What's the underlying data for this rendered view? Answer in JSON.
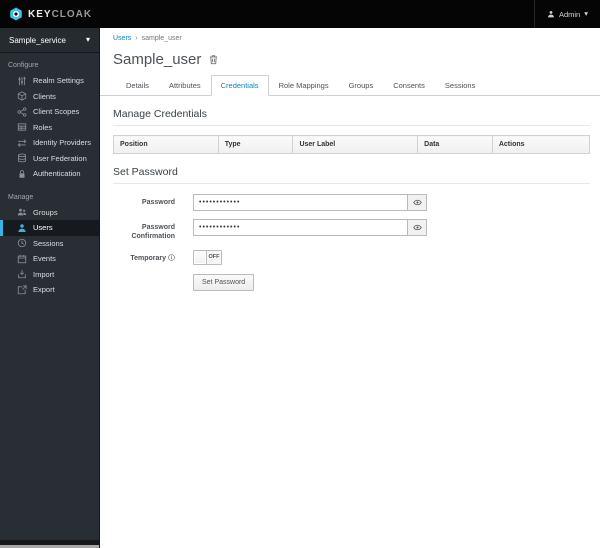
{
  "topbar": {
    "brand_primary": "KEY",
    "brand_secondary": "CLOAK",
    "user_label": "Admin"
  },
  "sidebar": {
    "realm_name": "Sample_service",
    "sections": [
      {
        "label": "Configure",
        "items": [
          {
            "label": "Realm Settings",
            "icon": "sliders-icon"
          },
          {
            "label": "Clients",
            "icon": "cube-icon"
          },
          {
            "label": "Client Scopes",
            "icon": "share-nodes-icon"
          },
          {
            "label": "Roles",
            "icon": "table-icon"
          },
          {
            "label": "Identity Providers",
            "icon": "arrows-swap-icon"
          },
          {
            "label": "User Federation",
            "icon": "database-icon"
          },
          {
            "label": "Authentication",
            "icon": "lock-icon"
          }
        ]
      },
      {
        "label": "Manage",
        "items": [
          {
            "label": "Groups",
            "icon": "group-icon"
          },
          {
            "label": "Users",
            "icon": "user-icon",
            "active": true
          },
          {
            "label": "Sessions",
            "icon": "clock-icon"
          },
          {
            "label": "Events",
            "icon": "calendar-icon"
          },
          {
            "label": "Import",
            "icon": "import-icon"
          },
          {
            "label": "Export",
            "icon": "export-icon"
          }
        ]
      }
    ]
  },
  "breadcrumb": {
    "root": "Users",
    "separator": "›",
    "current": "sample_user"
  },
  "page": {
    "title": "Sample_user"
  },
  "tabs": {
    "active": "Credentials",
    "items": [
      "Details",
      "Attributes",
      "Credentials",
      "Role Mappings",
      "Groups",
      "Consents",
      "Sessions"
    ]
  },
  "manage_credentials": {
    "heading": "Manage Credentials",
    "columns": [
      "Position",
      "Type",
      "User Label",
      "Data",
      "Actions"
    ]
  },
  "set_password": {
    "heading": "Set Password",
    "password_label": "Password",
    "confirmation_label": "Password Confirmation",
    "masked_value": "••••••••••••",
    "temporary_label": "Temporary",
    "toggle_state": "OFF",
    "button_label": "Set Password"
  },
  "colors": {
    "accent_blue": "#0088ce",
    "brand_cyan": "#3bc1e3",
    "selected_border": "#39b4e0",
    "sidebar_bg": "#292e34",
    "topbar_bg": "#050505"
  }
}
